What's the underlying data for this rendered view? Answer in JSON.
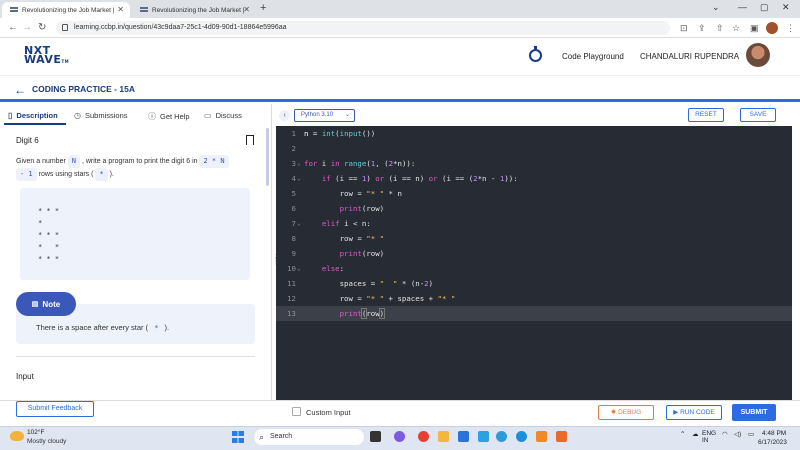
{
  "browser": {
    "tabs": [
      {
        "title": "Revolutionizing the Job Market |",
        "active": true
      },
      {
        "title": "Revolutionizing the Job Market |",
        "active": false
      }
    ],
    "url": "learning.ccbp.in/question/43c9daa7-25c1-4d09-90d1-18864e5996aa"
  },
  "header": {
    "logo_line1": "NXT",
    "logo_line2": "WAVE",
    "logo_tm": "TM",
    "code_playground": "Code Playground",
    "user_name": "CHANDALURI RUPENDRA"
  },
  "practice": {
    "title": "CODING PRACTICE - 15A"
  },
  "left_tabs": [
    {
      "label": "Description",
      "icon": "document-icon",
      "active": true
    },
    {
      "label": "Submissions",
      "icon": "clock-icon",
      "active": false
    },
    {
      "label": "Get Help",
      "icon": "help-icon",
      "active": false
    },
    {
      "label": "Discuss",
      "icon": "chat-icon",
      "active": false
    }
  ],
  "problem": {
    "title": "Digit 6",
    "desc_p1": "Given a number",
    "chip_n": "N",
    "desc_p2": ", write a program to print the digit",
    "digit": "6",
    "desc_p3": "in",
    "chip_expr_a": "2 * N",
    "chip_expr_b": "- 1",
    "desc_p4": "rows using stars (",
    "chip_star": "*",
    "desc_p5": ").",
    "pattern": "* * *\n*\n* * *\n*   *\n* * *",
    "note_label": "Note",
    "note_text_a": "There is a space after every star (",
    "note_star": "*",
    "note_text_b": ").",
    "input_heading": "Input"
  },
  "editor": {
    "language": "Python 3.10",
    "reset_label": "RESET",
    "save_label": "SAVE",
    "current_line": 13
  },
  "bottom": {
    "submit_feedback": "Submit Feedback",
    "custom_input": "Custom Input",
    "debug": "DEBUG",
    "run_code": "RUN CODE",
    "submit": "SUBMIT"
  },
  "taskbar": {
    "temperature": "102°F",
    "weather": "Mostly cloudy",
    "search_placeholder": "Search",
    "lang_top": "ENG",
    "lang_bottom": "IN",
    "time": "4:48 PM",
    "date": "6/17/2023"
  },
  "colors": {
    "brand": "#183b7d",
    "accent": "#2e6ae0",
    "editor_bg": "#272b33",
    "debug": "#e37a3a"
  }
}
